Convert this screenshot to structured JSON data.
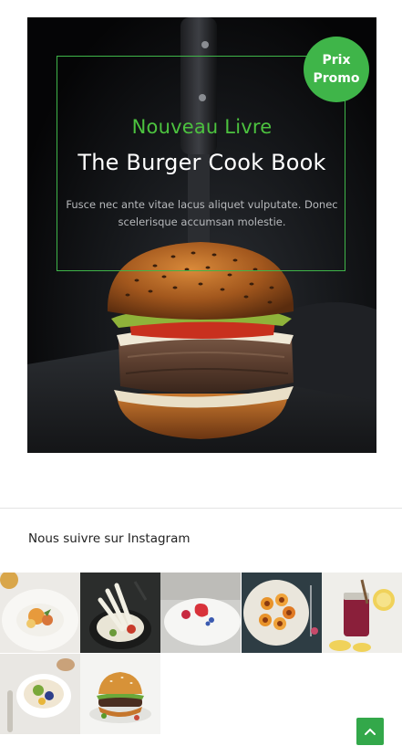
{
  "promo": {
    "kicker": "Nouveau Livre",
    "title": "The Burger Cook Book",
    "description": "Fusce nec ante vitae lacus aliquet vulputate. Donec scelerisque accumsan molestie.",
    "badge_line1": "Prix",
    "badge_line2": "Promo",
    "accent_color": "#3fb549"
  },
  "instagram": {
    "heading": "Nous suivre sur Instagram",
    "photos": [
      "plated-dish-photo",
      "noodle-bowl-photo",
      "strawberry-dessert-photo",
      "fruit-plate-photo",
      "berry-drink-photo",
      "breakfast-bowl-photo",
      "burger-photo"
    ]
  },
  "back_to_top": {
    "icon": "chevron-up-icon",
    "color": "#33a84a"
  }
}
